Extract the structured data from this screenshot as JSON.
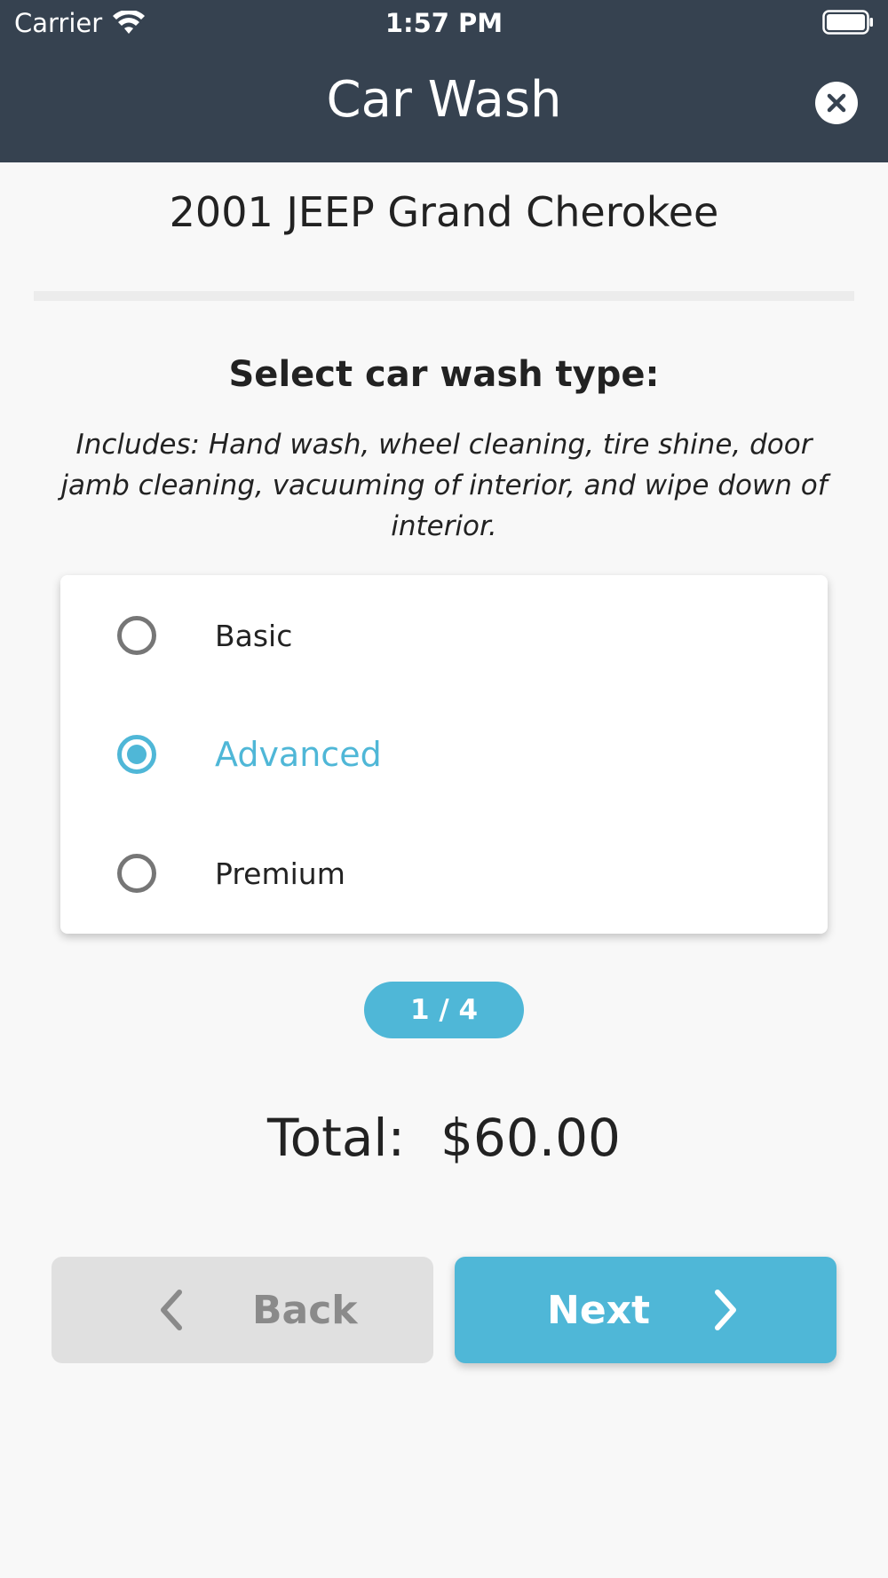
{
  "status_bar": {
    "carrier": "Carrier",
    "time": "1:57 PM"
  },
  "header": {
    "title": "Car Wash",
    "close_icon": "close-icon"
  },
  "vehicle": {
    "name": "2001 JEEP Grand Cherokee"
  },
  "prompt": {
    "title": "Select car wash type:",
    "includes": "Includes: Hand wash, wheel cleaning, tire shine, door jamb cleaning, vacuuming of interior, and wipe down of interior."
  },
  "options": [
    {
      "label": "Basic",
      "selected": false
    },
    {
      "label": "Advanced",
      "selected": true
    },
    {
      "label": "Premium",
      "selected": false
    }
  ],
  "step": {
    "text": "1 / 4"
  },
  "total": {
    "label": "Total:",
    "value": "$60.00"
  },
  "buttons": {
    "back_label": "Back",
    "next_label": "Next"
  },
  "colors": {
    "header_bg": "#364250",
    "accent": "#4fb7d7",
    "back_bg": "#e0e0e0",
    "page_bg": "#f8f8f8"
  }
}
